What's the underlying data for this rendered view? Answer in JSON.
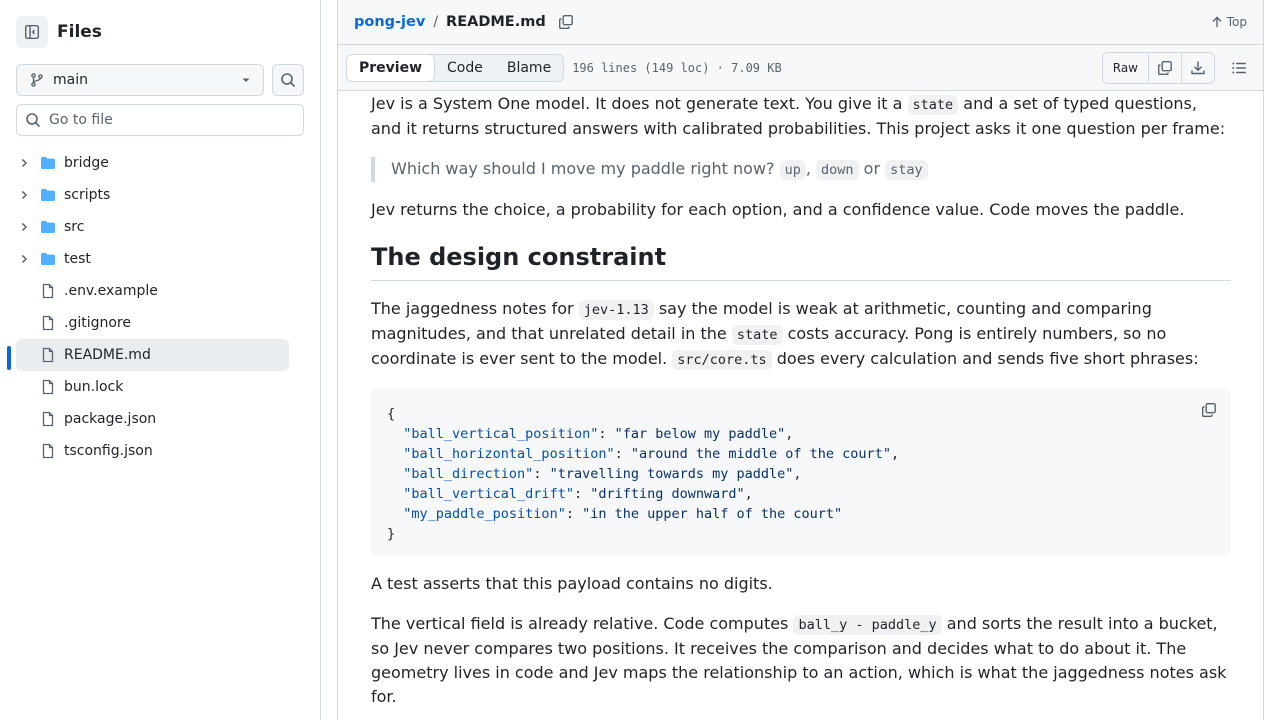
{
  "sidebar": {
    "title": "Files",
    "branch": "main",
    "goto_placeholder": "Go to file",
    "folders": [
      "bridge",
      "scripts",
      "src",
      "test"
    ],
    "files": [
      ".env.example",
      ".gitignore",
      "README.md",
      "bun.lock",
      "package.json",
      "tsconfig.json"
    ],
    "selected_file": "README.md"
  },
  "header": {
    "repo": "pong-jev",
    "separator": "/",
    "file": "README.md",
    "top_label": "Top"
  },
  "toolbar": {
    "tabs": [
      "Preview",
      "Code",
      "Blame"
    ],
    "active_tab": "Preview",
    "file_info": "196 lines (149 loc) · 7.09 KB",
    "raw_label": "Raw"
  },
  "content": {
    "p1": {
      "a": "Jev is a System One model. It does not generate text. You give it a ",
      "code": "state",
      "b": " and a set of typed questions, and it returns structured answers with calibrated probabilities. This project asks it one question per frame:"
    },
    "quote": {
      "text": "Which way should I move my paddle right now? ",
      "opt1": "up",
      "sep1": ", ",
      "opt2": "down",
      "sep2": " or ",
      "opt3": "stay"
    },
    "p2": "Jev returns the choice, a probability for each option, and a confidence value. Code moves the paddle.",
    "h2": "The design constraint",
    "p3": {
      "a": "The jaggedness notes for ",
      "code1": "jev-1.13",
      "b": " say the model is weak at arithmetic, counting and comparing magnitudes, and that unrelated detail in the ",
      "code2": "state",
      "c": " costs accuracy. Pong is entirely numbers, so no coordinate is ever sent to the model. ",
      "code3": "src/core.ts",
      "d": " does every calculation and sends five short phrases:"
    },
    "code_block": {
      "open": "{",
      "close": "}",
      "entries": [
        {
          "key": "\"ball_vertical_position\"",
          "value": "\"far below my paddle\"",
          "trail": ","
        },
        {
          "key": "\"ball_horizontal_position\"",
          "value": "\"around the middle of the court\"",
          "trail": ","
        },
        {
          "key": "\"ball_direction\"",
          "value": "\"travelling towards my paddle\"",
          "trail": ","
        },
        {
          "key": "\"ball_vertical_drift\"",
          "value": "\"drifting downward\"",
          "trail": ","
        },
        {
          "key": "\"my_paddle_position\"",
          "value": "\"in the upper half of the court\"",
          "trail": ""
        }
      ]
    },
    "p4": "A test asserts that this payload contains no digits.",
    "p5": {
      "a": "The vertical field is already relative. Code computes ",
      "code": "ball_y - paddle_y",
      "b": " and sorts the result into a bucket, so Jev never compares two positions. It receives the comparison and decides what to do about it. The geometry lives in code and Jev maps the relationship to an action, which is what the jaggedness notes ask for."
    }
  }
}
